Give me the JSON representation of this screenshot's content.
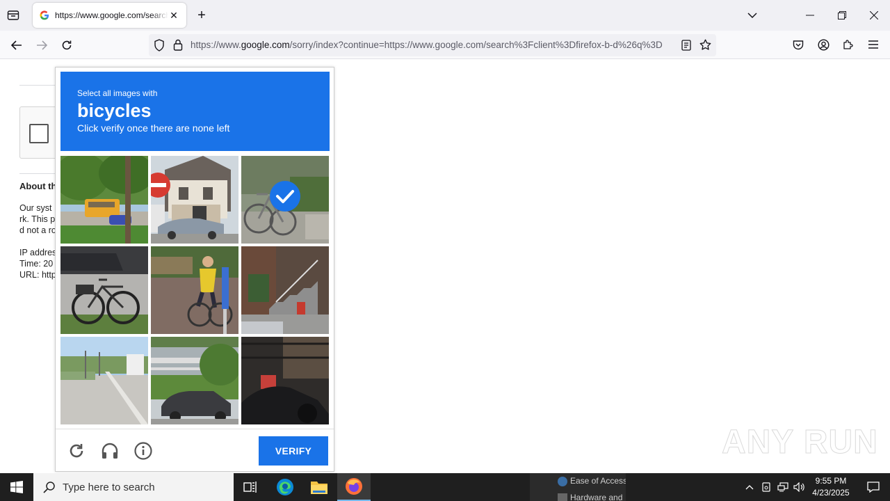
{
  "browser": {
    "tab_title": "https://www.google.com/search",
    "url_prefix": "https://www.",
    "url_domain": "google.com",
    "url_rest": "/sorry/index?continue=https://www.google.com/search%3Fclient%3Dfirefox-b-d%26q%3D"
  },
  "page": {
    "about_title": "About th",
    "para_lines": [
      "Our syst",
      "rk. This p",
      "d not a ro"
    ],
    "info_lines": [
      "IP addres",
      "Time: 20",
      "URL: http"
    ]
  },
  "challenge": {
    "instruction_small": "Select all images with",
    "target_word": "bicycles",
    "instruction_sub": "Click verify once there are none left",
    "selected_tiles": [
      3
    ],
    "verify_label": "VERIFY"
  },
  "watermark": "ANY RUN",
  "taskbar": {
    "search_placeholder": "Type here to search",
    "tray_items": [
      "Ease of Access",
      "Hardware and"
    ],
    "time": "9:55 PM",
    "date": "4/23/2025"
  },
  "colors": {
    "accent": "#1a73e8",
    "taskbar": "#1f1f1f"
  }
}
